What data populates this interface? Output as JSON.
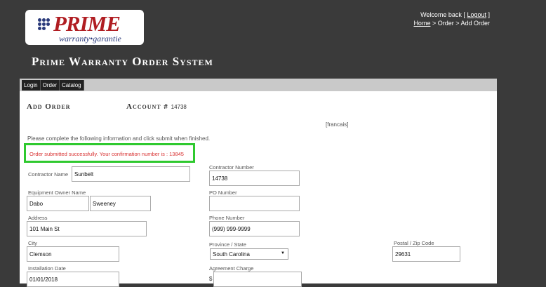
{
  "logo": {
    "title": "PRIME",
    "subtitle": "warranty•garantie"
  },
  "header": {
    "welcome_prefix": "Welcome back [",
    "logout": "Logout",
    "welcome_suffix": "]",
    "breadcrumb_home": "Home",
    "breadcrumb_rest": " > Order > Add Order",
    "site_title": "Prime Warranty Order System"
  },
  "menu": [
    "Login",
    "Order",
    "Catalog"
  ],
  "page": {
    "heading": "Add Order",
    "account_label": "Account #",
    "account_number": "14738",
    "language_link": "[francais]",
    "instructions": "Please complete the following information and click submit when finished.",
    "success_message": "Order submitted successfully. Your confirmation number is : 13845"
  },
  "form": {
    "contractor_name": {
      "label": "Contractor Name",
      "value": "Sunbelt"
    },
    "contractor_number": {
      "label": "Contractor Number",
      "value": "14738"
    },
    "equipment_owner": {
      "label": "Equipment Owner Name",
      "first": "Dabo",
      "last": "Sweeney"
    },
    "po_number": {
      "label": "PO Number",
      "value": ""
    },
    "address": {
      "label": "Address",
      "value": "101 Main St"
    },
    "phone": {
      "label": "Phone Number",
      "value": "(999) 999-9999"
    },
    "city": {
      "label": "City",
      "value": "Clemson"
    },
    "province": {
      "label": "Province / State",
      "value": "South Carolina"
    },
    "postal": {
      "label": "Postal / Zip Code",
      "value": "29631"
    },
    "installation_date": {
      "label": "Installation Date",
      "value": "01/01/2018"
    },
    "agreement_charge": {
      "label": "Agreement Charge",
      "currency": "$",
      "value": ""
    }
  }
}
